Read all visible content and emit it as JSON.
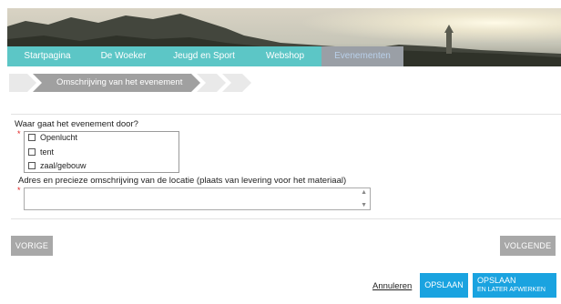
{
  "nav": {
    "tabs": [
      {
        "label": "Startpagina"
      },
      {
        "label": "De Woeker"
      },
      {
        "label": "Jeugd en Sport"
      },
      {
        "label": "Webshop"
      },
      {
        "label": "Evenementen",
        "active": true
      }
    ]
  },
  "steps": {
    "current_label": "Omschrijving van het evenement",
    "total_visible": 3
  },
  "form": {
    "question": "Waar gaat het evenement door?",
    "required_mark": "*",
    "options": [
      {
        "label": "Openlucht",
        "checked": false
      },
      {
        "label": "tent",
        "checked": false
      },
      {
        "label": "zaal/gebouw",
        "checked": false
      }
    ],
    "address_label": "Adres en precieze omschrijving van de locatie (plaats van levering voor het materiaal)",
    "address_value": ""
  },
  "navigation": {
    "prev_label": "VORIGE",
    "next_label": "VOLGENDE"
  },
  "actions": {
    "cancel_label": "Annuleren",
    "save_label": "OPSLAAN",
    "save_later_line1": "OPSLAAN",
    "save_later_line2": "EN LATER AFWERKEN"
  },
  "colors": {
    "nav_tab": "#5cc6c6",
    "nav_tab_active": "#9a9fa6",
    "step_active": "#a0a0a0",
    "step_inactive": "#e9e9e9",
    "button_grey": "#a8a8a8",
    "button_blue": "#1aa3e0",
    "required": "#e02020"
  }
}
